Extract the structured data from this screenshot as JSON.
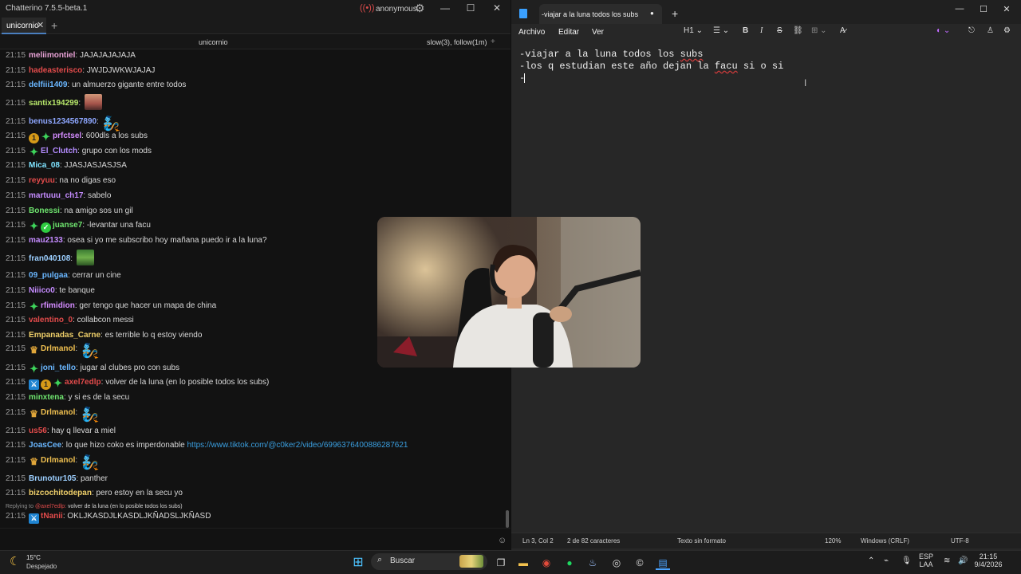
{
  "chat_app": {
    "title": "Chatterino 7.5.5-beta.1",
    "account": "anonymous",
    "tabs": [
      {
        "label": "unicornio"
      }
    ],
    "channel": "unicornio",
    "mode": "slow(3), follow(1m)"
  },
  "messages": [
    {
      "time": "21:15",
      "user": "meliimontiel",
      "color": "#e8a2d6",
      "text": "JAJAJAJAJAJA"
    },
    {
      "time": "21:15",
      "user": "hadeasterisco",
      "color": "#e24b4b",
      "text": "JWJDJWKWJAJAJ"
    },
    {
      "time": "21:15",
      "user": "delfiii1409",
      "color": "#6ab7ff",
      "text": "un almuerzo gigante entre todos"
    },
    {
      "time": "21:15",
      "user": "santix194299",
      "color": "#b8e86b",
      "text": "",
      "emote": "face"
    },
    {
      "time": "21:15",
      "user": "benus1234567890",
      "color": "#8ea7ff",
      "text": "",
      "emote": "fig"
    },
    {
      "time": "21:15",
      "user": "prfctsel",
      "color": "#d48cff",
      "text": "600dls a los subs",
      "badges": [
        "sub",
        "vip"
      ]
    },
    {
      "time": "21:15",
      "user": "El_Clutch",
      "color": "#b48cff",
      "text": "grupo con los mods",
      "badges": [
        "vip"
      ]
    },
    {
      "time": "21:15",
      "user": "Mica_08",
      "color": "#7fe3ff",
      "text": "JJASJASJASJSA"
    },
    {
      "time": "21:15",
      "user": "reyyuu",
      "color": "#e24b4b",
      "text": "na no digas eso"
    },
    {
      "time": "21:15",
      "user": "martuuu_ch17",
      "color": "#c58cff",
      "text": "sabelo"
    },
    {
      "time": "21:15",
      "user": "Bonessi",
      "color": "#6fe56f",
      "text": "na amigo sos un gil"
    },
    {
      "time": "21:15",
      "user": "juanse7",
      "color": "#6fe56f",
      "text": "-levantar una facu",
      "badges": [
        "vip",
        "verified"
      ]
    },
    {
      "time": "21:15",
      "user": "mau2133",
      "color": "#c58cff",
      "text": "osea si yo me subscribo hoy mañana puedo ir a la luna?"
    },
    {
      "time": "21:15",
      "user": "fran040108",
      "color": "#9ccfff",
      "text": "",
      "emote": "frog"
    },
    {
      "time": "21:15",
      "user": "09_pulgaa",
      "color": "#6ab7ff",
      "text": "cerrar un cine"
    },
    {
      "time": "21:15",
      "user": "Niiico0",
      "color": "#c58cff",
      "text": "te banque"
    },
    {
      "time": "21:15",
      "user": "rfimidion",
      "color": "#d48cff",
      "text": "ger tengo que hacer un mapa de china",
      "badges": [
        "vip"
      ]
    },
    {
      "time": "21:15",
      "user": "valentino_0",
      "color": "#e24b4b",
      "text": "collabcon messi"
    },
    {
      "time": "21:15",
      "user": "Empanadas_Carne",
      "color": "#f0d06a",
      "text": "es terrible lo q estoy viendo"
    },
    {
      "time": "21:15",
      "user": "Drlmanol",
      "color": "#f0c050",
      "text": "",
      "badges": [
        "crown"
      ],
      "emote": "fig"
    },
    {
      "time": "21:15",
      "user": "joni_tello",
      "color": "#6ab7ff",
      "text": "jugar al clubes pro con subs",
      "badges": [
        "vip"
      ]
    },
    {
      "time": "21:15",
      "user": "axel7edlp",
      "color": "#e24b4b",
      "text": "volver de la luna (en lo posible todos los subs)",
      "badges": [
        "mod",
        "sub",
        "vip"
      ]
    },
    {
      "time": "21:15",
      "user": "minxtena",
      "color": "#6fe56f",
      "text": "y si es de la secu"
    },
    {
      "time": "21:15",
      "user": "Drlmanol",
      "color": "#f0c050",
      "text": "",
      "badges": [
        "crown"
      ],
      "emote": "fig"
    },
    {
      "time": "21:15",
      "user": "us56",
      "color": "#e24b4b",
      "text": "hay q llevar a miel"
    },
    {
      "time": "21:15",
      "user": "JoasCee",
      "color": "#6ab7ff",
      "text": "lo que hizo coko es imperdonable ",
      "link": "https://www.tiktok.com/@c0ker2/video/6996376400886287621"
    },
    {
      "time": "21:15",
      "user": "Drlmanol",
      "color": "#f0c050",
      "text": "",
      "badges": [
        "crown"
      ],
      "emote": "fig"
    },
    {
      "time": "21:15",
      "user": "Brunotur105",
      "color": "#9ccfff",
      "text": "panther"
    },
    {
      "time": "21:15",
      "user": "bizcochitodepan",
      "color": "#f0d06a",
      "text": "pero estoy en la secu yo"
    },
    {
      "time": "21:15",
      "user": "tNanii",
      "color": "#e24b4b",
      "text": "OKLJKASDJLKASDLJKÑADSLJKÑASD",
      "badges": [
        "mod"
      ]
    }
  ],
  "reply": {
    "prefix": "Replying to",
    "user": "@axel7edlp:",
    "text": "volver de la luna (en lo posible todos los subs)"
  },
  "notepad": {
    "tab_title": "-viajar a la luna todos los subs",
    "menu": [
      "Archivo",
      "Editar",
      "Ver"
    ],
    "heading": "H1",
    "lines": [
      "-viajar a la luna todos los ",
      "-los q estudian este año dejan la ",
      "-"
    ],
    "line1_word": "subs",
    "line2_word": "facu",
    "line2_tail": " si o si",
    "status": {
      "pos": "Ln 3, Col 2",
      "chars": "2 de 82 caracteres",
      "format": "Texto sin formato",
      "zoom": "120%",
      "eol": "Windows (CRLF)",
      "enc": "UTF-8"
    }
  },
  "taskbar": {
    "weather_temp": "15°C",
    "weather_desc": "Despejado",
    "search": "Buscar",
    "lang1": "ESP",
    "lang2": "LAA",
    "time": "21:15",
    "date": "9/4/2026"
  }
}
